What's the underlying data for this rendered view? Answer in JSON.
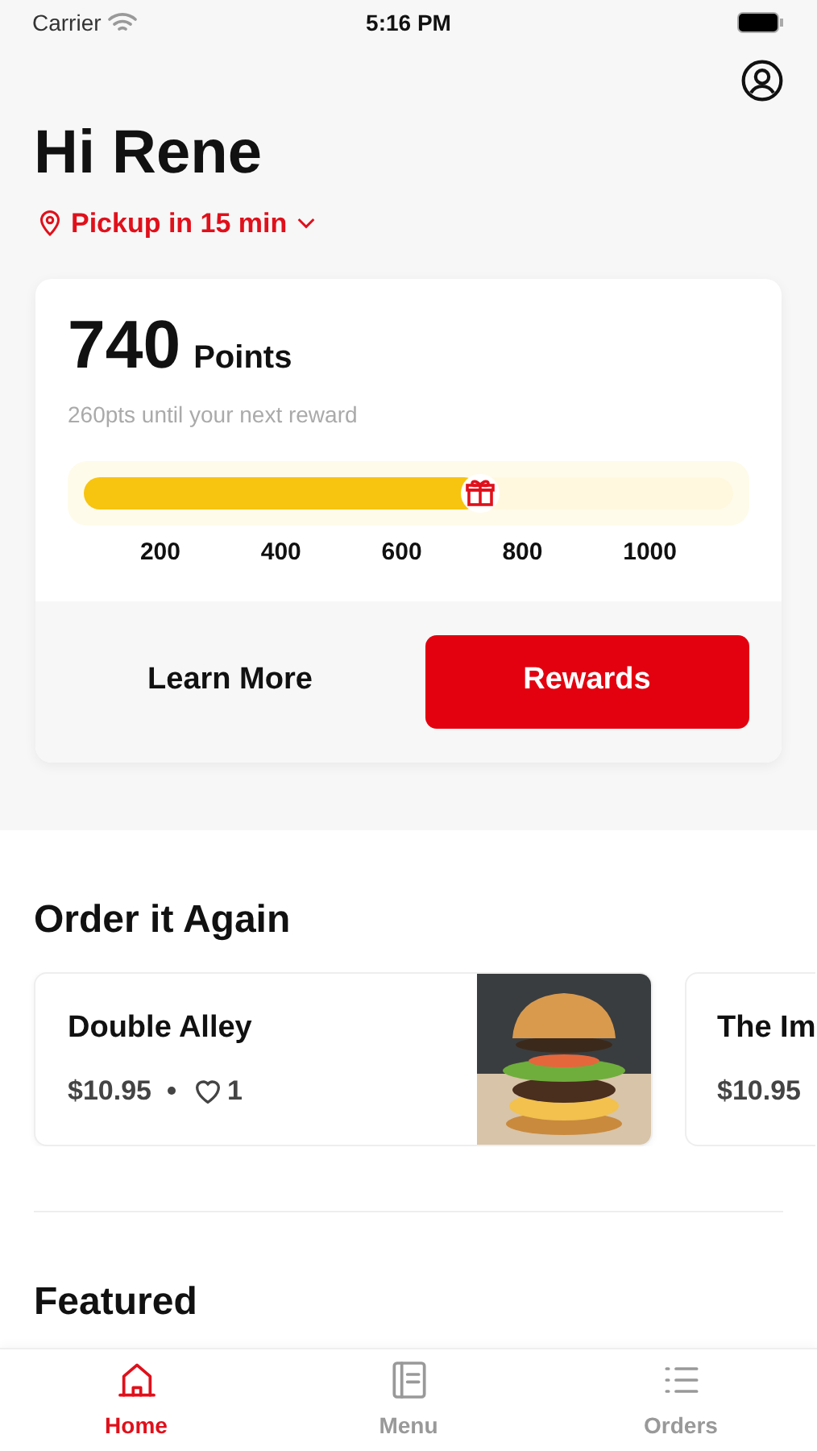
{
  "status_bar": {
    "carrier": "Carrier",
    "time": "5:16 PM"
  },
  "greeting": "Hi Rene",
  "pickup": "Pickup in 15 min",
  "rewards": {
    "points": "740",
    "points_label": "Points",
    "subtitle": "260pts until your next reward",
    "level": 0.61,
    "ticks": [
      "200",
      "400",
      "600",
      "800",
      "1000"
    ],
    "buttons": [
      "Learn More",
      "Rewards"
    ]
  },
  "order_again": {
    "title": "Order it Again",
    "items": [
      {
        "name": "Double Alley",
        "price": "$10.95",
        "likes": "1",
        "kind": "full"
      },
      {
        "name": "The Im",
        "price": "$10.95",
        "kind": "cut"
      }
    ]
  },
  "featured": {
    "title": "Featured"
  },
  "tabs": [
    {
      "label": "Home",
      "selected": true,
      "kind": "home"
    },
    {
      "label": "Menu",
      "selected": false,
      "kind": "menu"
    },
    {
      "label": "Orders",
      "selected": false,
      "kind": "orders"
    }
  ]
}
